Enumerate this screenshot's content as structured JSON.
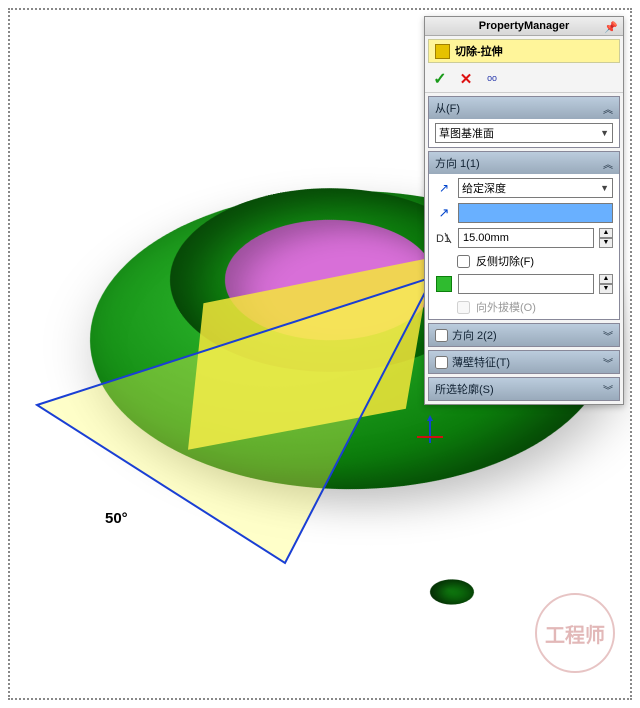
{
  "pm": {
    "title": "PropertyManager",
    "feature_label": "切除-拉伸",
    "actions": {
      "ok_glyph": "✓",
      "cancel_glyph": "✕",
      "detail_glyph": "ᵒᵒ"
    },
    "from": {
      "header": "从(F)",
      "plane_option": "草图基准面"
    },
    "dir1": {
      "header": "方向 1(1)",
      "end_condition": "给定深度",
      "distance_value": "",
      "depth_value": "15.00mm",
      "flip_side_label": "反侧切除(F)",
      "draft_outward_label": "向外拔模(O)",
      "draft_value": ""
    },
    "dir2": {
      "header": "方向 2(2)"
    },
    "thin": {
      "header": "薄壁特征(T)"
    },
    "contours": {
      "header": "所选轮廓(S)"
    }
  },
  "viewport": {
    "angle_dim": "50°"
  },
  "watermark": "工程师"
}
